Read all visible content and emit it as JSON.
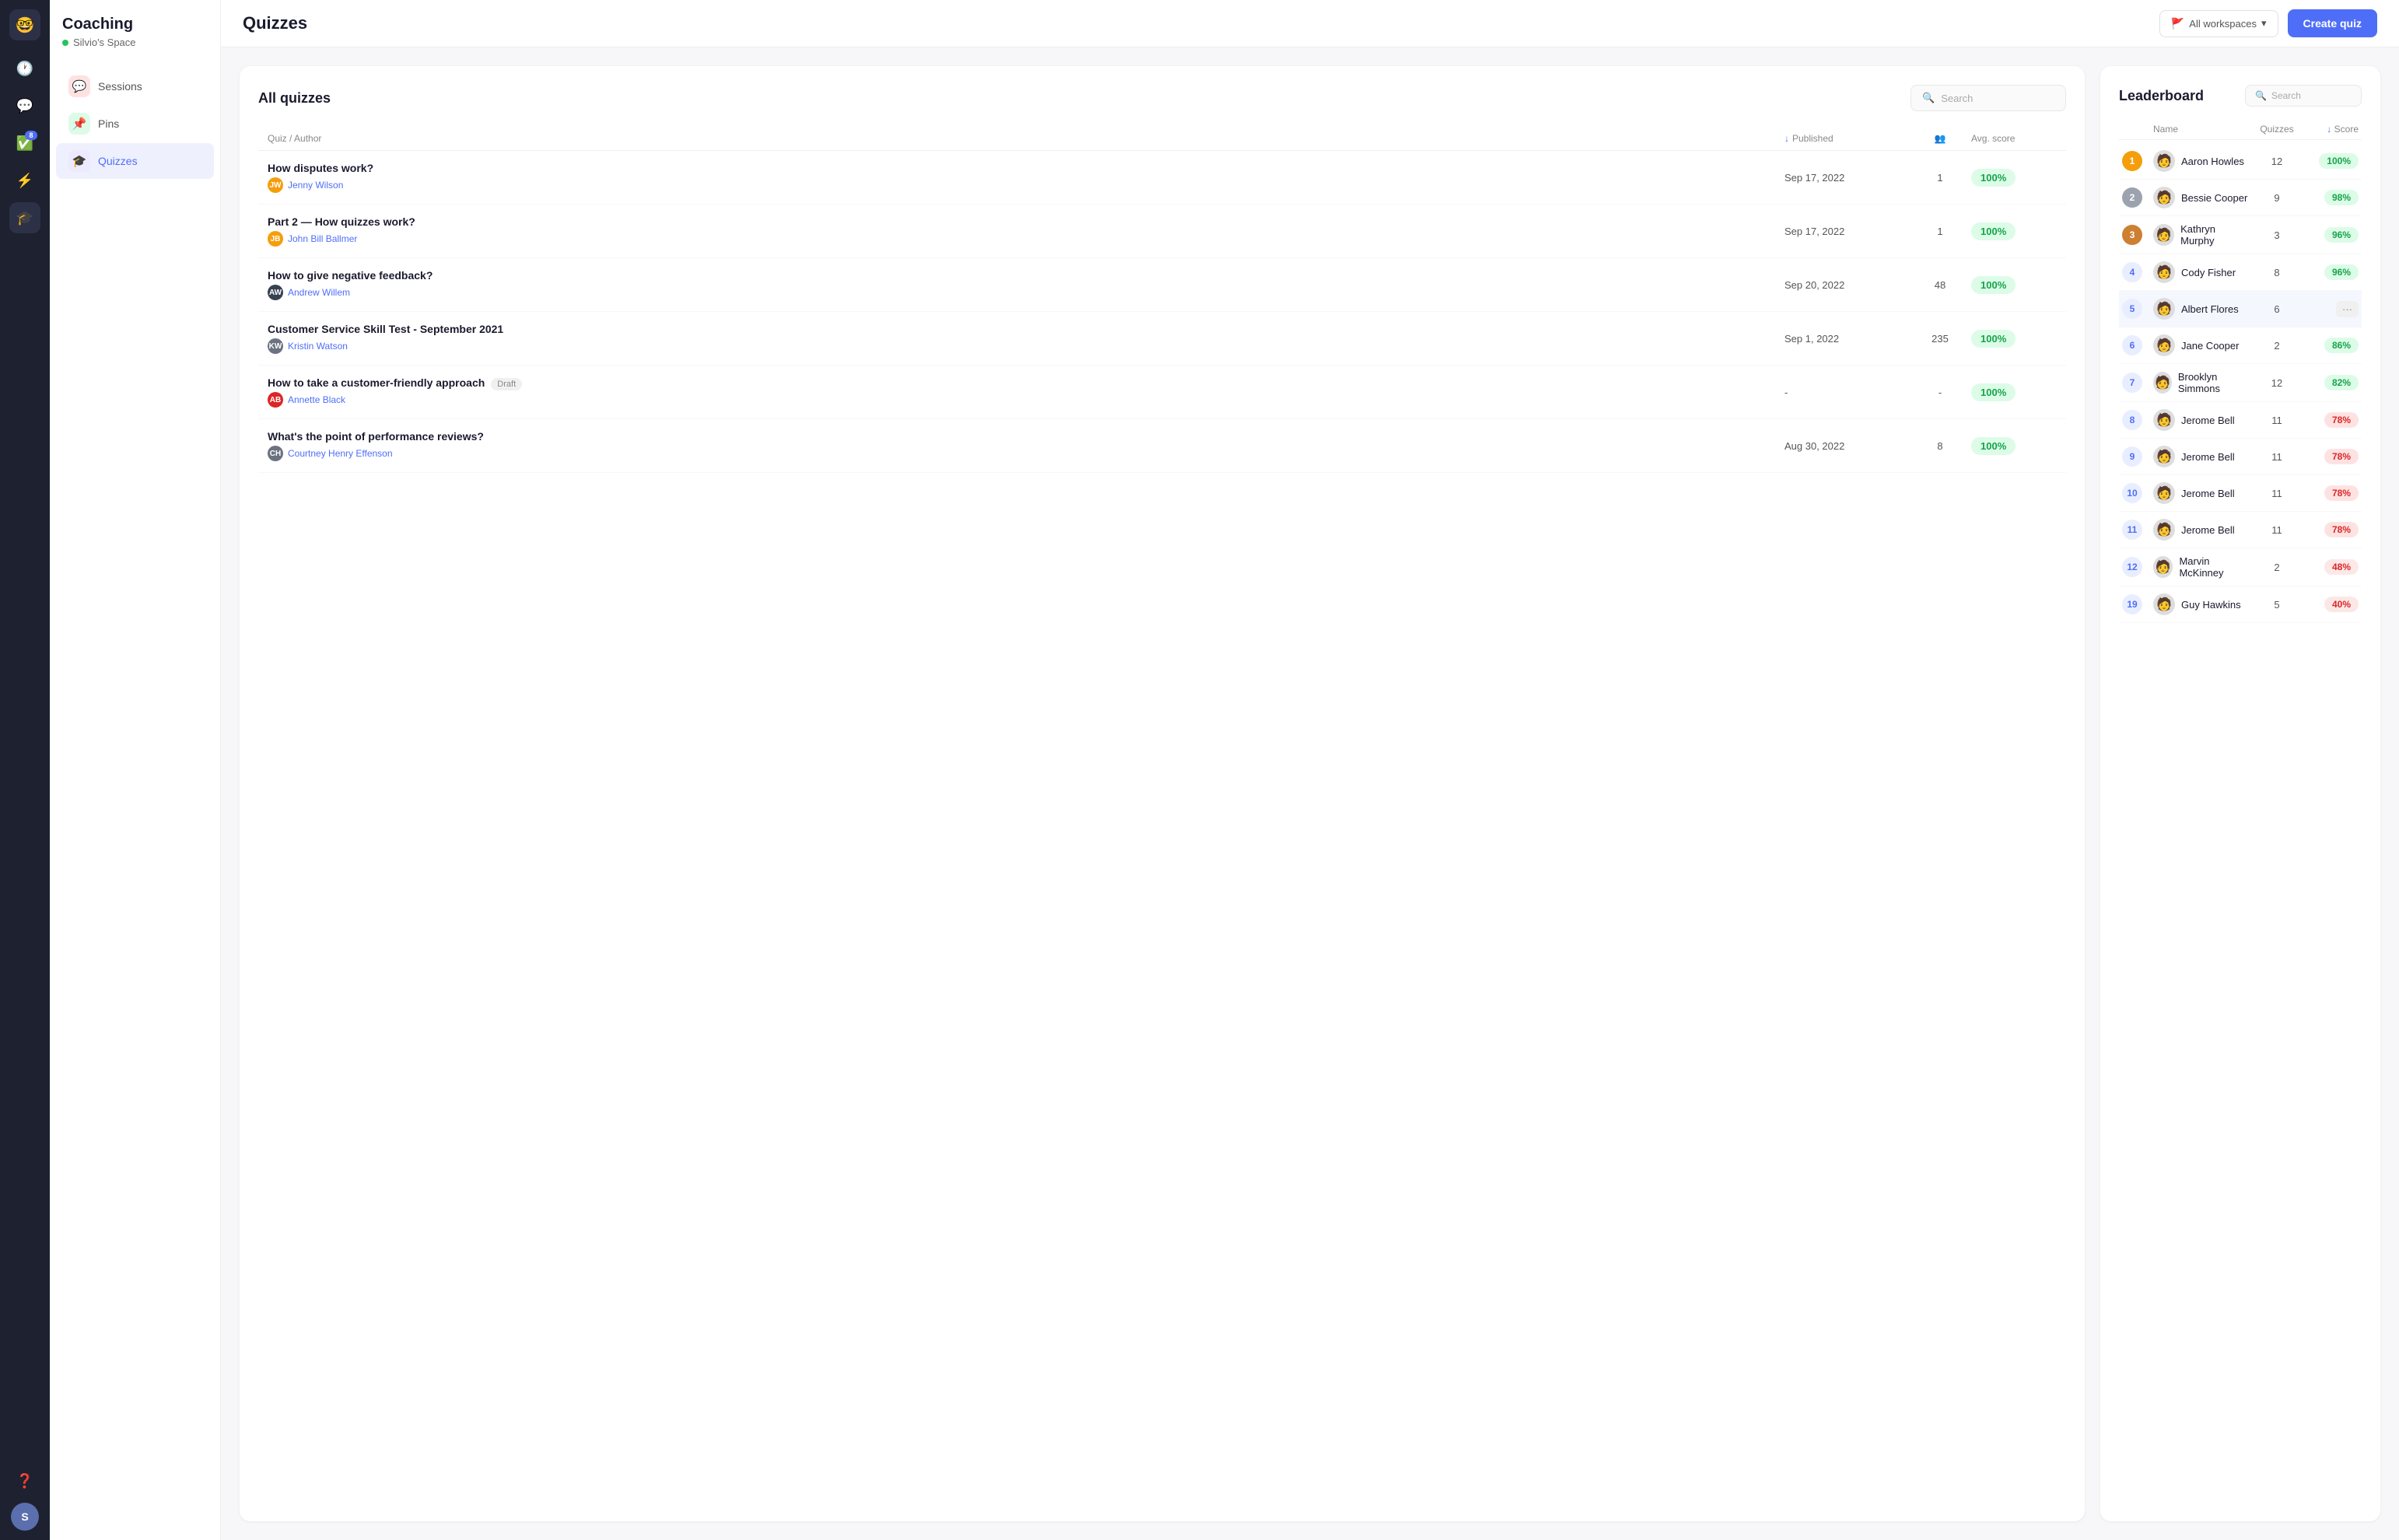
{
  "app": {
    "logo": "🤓",
    "nav_icons": [
      "🕐",
      "💬",
      "✅",
      "⚡",
      "🎓",
      "❓"
    ],
    "badge_count": "8"
  },
  "sidebar": {
    "brand": "Coaching",
    "space_name": "Silvio's Space",
    "items": [
      {
        "id": "sessions",
        "label": "Sessions",
        "icon": "💬",
        "icon_class": "icon-sessions"
      },
      {
        "id": "pins",
        "label": "Pins",
        "icon": "📌",
        "icon_class": "icon-pins"
      },
      {
        "id": "quizzes",
        "label": "Quizzes",
        "icon": "🎓",
        "icon_class": "icon-quizzes",
        "active": true
      }
    ]
  },
  "topbar": {
    "title": "Quizzes",
    "workspace_label": "All workspaces",
    "create_button": "Create quiz"
  },
  "quizzes_panel": {
    "title": "All quizzes",
    "search_placeholder": "Search",
    "columns": {
      "quiz_author": "Quiz / Author",
      "published": "Published",
      "participants": "",
      "avg_score": "Avg. score"
    },
    "rows": [
      {
        "name": "How disputes work?",
        "author": "Jenny Wilson",
        "author_color": "#f59e0b",
        "author_initials": "JW",
        "published": "Sep 17, 2022",
        "participants": "1",
        "avg_score": "100%",
        "draft": false
      },
      {
        "name": "Part 2 — How quizzes work?",
        "author": "John Bill Ballmer",
        "author_color": "#f59e0b",
        "author_initials": "JB",
        "published": "Sep 17, 2022",
        "participants": "1",
        "avg_score": "100%",
        "draft": false
      },
      {
        "name": "How to give negative feedback?",
        "author": "Andrew Willem",
        "author_color": "#374151",
        "author_initials": "AW",
        "published": "Sep 20, 2022",
        "participants": "48",
        "avg_score": "100%",
        "draft": false
      },
      {
        "name": "Customer Service Skill Test - September 2021",
        "author": "Kristin Watson",
        "author_color": "#6b7280",
        "author_initials": "KW",
        "published": "Sep 1, 2022",
        "participants": "235",
        "avg_score": "100%",
        "draft": false
      },
      {
        "name": "How to take a customer-friendly approach",
        "author": "Annette Black",
        "author_color": "#dc2626",
        "author_initials": "AB",
        "published": "-",
        "participants": "-",
        "avg_score": "100%",
        "draft": true,
        "draft_label": "Draft"
      },
      {
        "name": "What's the point of performance reviews?",
        "author": "Courtney Henry Effenson",
        "author_color": "#6b7280",
        "author_initials": "CH",
        "published": "Aug 30, 2022",
        "participants": "8",
        "avg_score": "100%",
        "draft": false
      }
    ]
  },
  "leaderboard": {
    "title": "Leaderboard",
    "search_placeholder": "Search",
    "columns": {
      "name": "Name",
      "quizzes": "Quizzes",
      "score": "Score"
    },
    "rows": [
      {
        "rank": "1",
        "rank_class": "rank-gold",
        "name": "Aaron Howles",
        "quizzes": "12",
        "score": "100%",
        "score_class": "score-high",
        "highlighted": false
      },
      {
        "rank": "2",
        "rank_class": "rank-silver",
        "name": "Bessie Cooper",
        "quizzes": "9",
        "score": "98%",
        "score_class": "score-high",
        "highlighted": false
      },
      {
        "rank": "3",
        "rank_class": "rank-bronze",
        "name": "Kathryn Murphy",
        "quizzes": "3",
        "score": "96%",
        "score_class": "score-high",
        "highlighted": false
      },
      {
        "rank": "4",
        "rank_class": "rank-blue",
        "name": "Cody Fisher",
        "quizzes": "8",
        "score": "96%",
        "score_class": "score-high",
        "highlighted": false
      },
      {
        "rank": "5",
        "rank_class": "rank-blue",
        "name": "Albert Flores",
        "quizzes": "6",
        "score": "...",
        "score_class": "",
        "highlighted": true
      },
      {
        "rank": "6",
        "rank_class": "rank-blue",
        "name": "Jane Cooper",
        "quizzes": "2",
        "score": "86%",
        "score_class": "score-high",
        "highlighted": false
      },
      {
        "rank": "7",
        "rank_class": "rank-blue",
        "name": "Brooklyn Simmons",
        "quizzes": "12",
        "score": "82%",
        "score_class": "score-high",
        "highlighted": false
      },
      {
        "rank": "8",
        "rank_class": "rank-blue",
        "name": "Jerome Bell",
        "quizzes": "11",
        "score": "78%",
        "score_class": "score-mid",
        "highlighted": false
      },
      {
        "rank": "9",
        "rank_class": "rank-blue",
        "name": "Jerome Bell",
        "quizzes": "11",
        "score": "78%",
        "score_class": "score-mid",
        "highlighted": false
      },
      {
        "rank": "10",
        "rank_class": "rank-blue",
        "name": "Jerome Bell",
        "quizzes": "11",
        "score": "78%",
        "score_class": "score-mid",
        "highlighted": false
      },
      {
        "rank": "11",
        "rank_class": "rank-blue",
        "name": "Jerome Bell",
        "quizzes": "11",
        "score": "78%",
        "score_class": "score-mid",
        "highlighted": false
      },
      {
        "rank": "12",
        "rank_class": "rank-blue",
        "name": "Marvin McKinney",
        "quizzes": "2",
        "score": "48%",
        "score_class": "score-low",
        "highlighted": false
      },
      {
        "rank": "19",
        "rank_class": "rank-blue",
        "name": "Guy Hawkins",
        "quizzes": "5",
        "score": "40%",
        "score_class": "score-very-low",
        "highlighted": false
      }
    ]
  }
}
